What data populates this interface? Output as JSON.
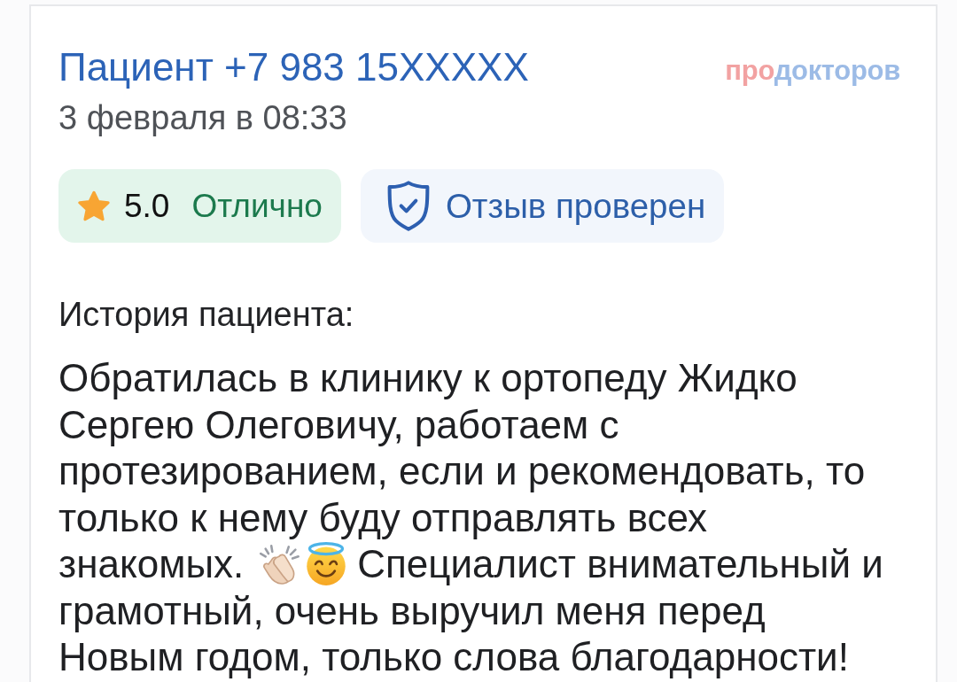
{
  "header": {
    "title": "Пациент +7 983 15XXXXX",
    "date": "3 февраля в 08:33",
    "logo": {
      "prefix": "про",
      "rest": "докторов"
    }
  },
  "badges": [
    {
      "kind": "rating",
      "value": "5.0",
      "label": "Отлично"
    },
    {
      "kind": "verified",
      "label": "Отзыв проверен"
    }
  ],
  "story": {
    "heading": "История пациента:",
    "text_start": "Обратилась в клинику к ортопеду Жидко Сергею Олеговичу, работаем с протезированием, если и рекомендовать, то только к нему буду отправлять всех",
    "emoji_line": {
      "before": "знакомых.",
      "after": "Специалист внимательный и"
    },
    "text_end": "грамотный, очень выручил меня перед Новым годом, только слова благодарности!"
  }
}
